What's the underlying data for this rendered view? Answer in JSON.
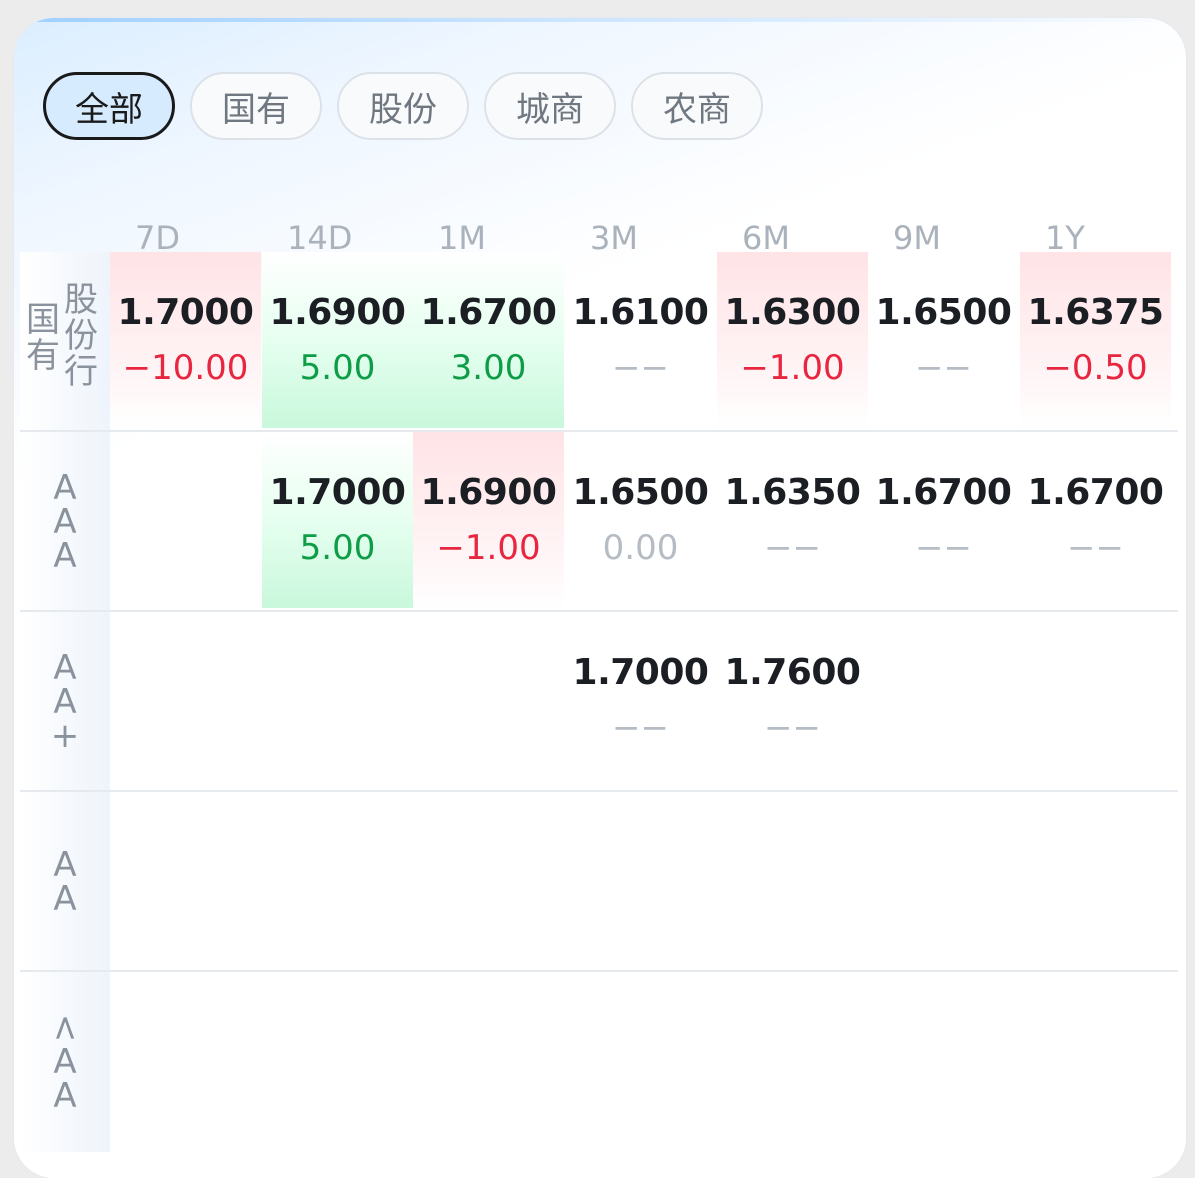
{
  "tabs": [
    {
      "label": "全部",
      "active": true
    },
    {
      "label": "国有",
      "active": false
    },
    {
      "label": "股份",
      "active": false
    },
    {
      "label": "城商",
      "active": false
    },
    {
      "label": "农商",
      "active": false
    }
  ],
  "columns": [
    "7D",
    "14D",
    "1M",
    "3M",
    "6M",
    "9M",
    "1Y"
  ],
  "rows": [
    {
      "label_col1": [
        "国",
        "有"
      ],
      "label_col2": [
        "股",
        "份",
        "行"
      ],
      "cells": [
        {
          "price": "1.7000",
          "change": "−10.00",
          "trend": "neg",
          "bg": "red"
        },
        {
          "price": "1.6900",
          "change": "5.00",
          "trend": "pos",
          "bg": "green"
        },
        {
          "price": "1.6700",
          "change": "3.00",
          "trend": "pos",
          "bg": "green"
        },
        {
          "price": "1.6100",
          "change": "−−",
          "trend": "none",
          "bg": ""
        },
        {
          "price": "1.6300",
          "change": "−1.00",
          "trend": "neg",
          "bg": "red"
        },
        {
          "price": "1.6500",
          "change": "−−",
          "trend": "none",
          "bg": ""
        },
        {
          "price": "1.6375",
          "change": "−0.50",
          "trend": "neg",
          "bg": "red"
        }
      ]
    },
    {
      "label": [
        "A",
        "A",
        "A"
      ],
      "cells": [
        null,
        {
          "price": "1.7000",
          "change": "5.00",
          "trend": "pos",
          "bg": "green"
        },
        {
          "price": "1.6900",
          "change": "−1.00",
          "trend": "neg",
          "bg": "red"
        },
        {
          "price": "1.6500",
          "change": "0.00",
          "trend": "zero",
          "bg": ""
        },
        {
          "price": "1.6350",
          "change": "−−",
          "trend": "none",
          "bg": ""
        },
        {
          "price": "1.6700",
          "change": "−−",
          "trend": "none",
          "bg": ""
        },
        {
          "price": "1.6700",
          "change": "−−",
          "trend": "none",
          "bg": ""
        }
      ]
    },
    {
      "label": [
        "A",
        "A",
        "+"
      ],
      "cells": [
        null,
        null,
        null,
        {
          "price": "1.7000",
          "change": "−−",
          "trend": "none",
          "bg": ""
        },
        {
          "price": "1.7600",
          "change": "−−",
          "trend": "none",
          "bg": ""
        },
        null,
        null
      ]
    },
    {
      "label": [
        "A",
        "A"
      ],
      "cells": [
        null,
        null,
        null,
        null,
        null,
        null,
        null
      ]
    },
    {
      "label": [
        "<",
        "A",
        "A"
      ],
      "cells": [
        null,
        null,
        null,
        null,
        null,
        null,
        null
      ]
    }
  ]
}
